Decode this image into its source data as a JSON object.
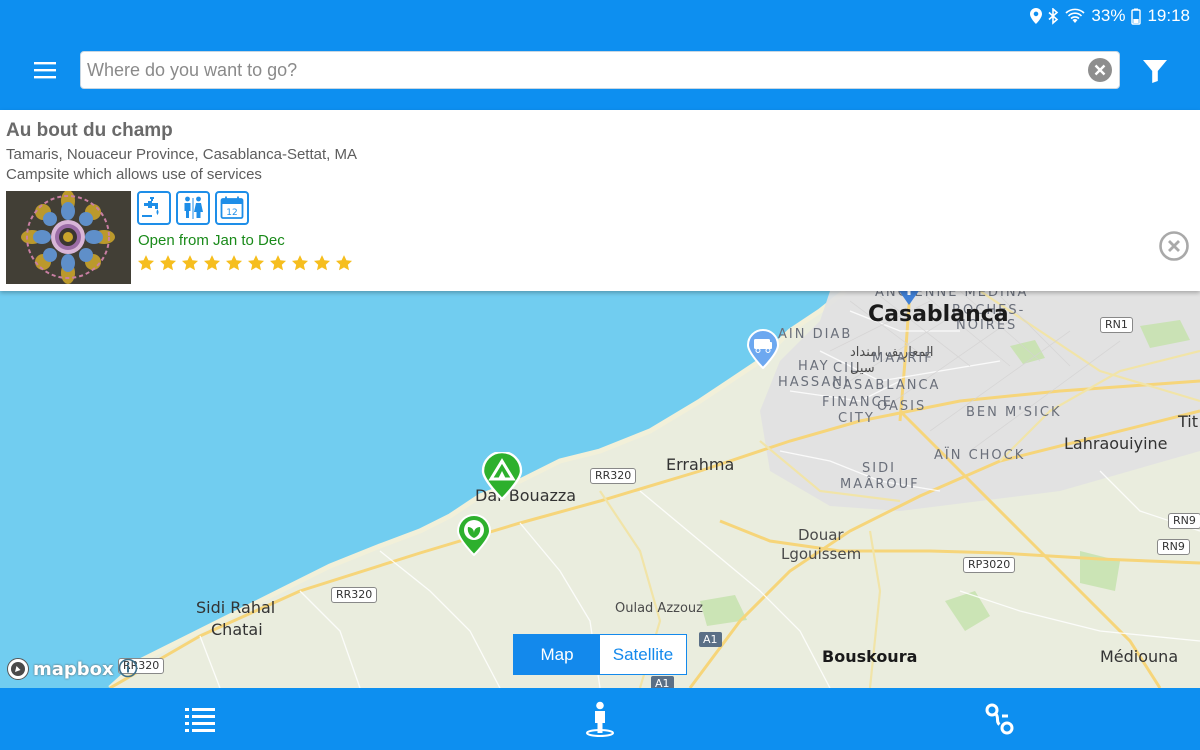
{
  "status_bar": {
    "battery": "33%",
    "time": "19:18"
  },
  "search": {
    "placeholder": "Where do you want to go?"
  },
  "place": {
    "name": "Au bout du champ",
    "address": "Tamaris, Nouaceur Province, Casablanca-Settat, MA",
    "type": "Campsite which allows use of services",
    "services": [
      "water-tap-icon",
      "toilets-icon",
      "calendar-icon"
    ],
    "calendar_number": "12",
    "opening": "Open from Jan to Dec",
    "rating": 10
  },
  "map": {
    "labels": {
      "casablanca": "Casablanca",
      "ain_diab": "AIN DIAB",
      "hay_hassani": "HAY",
      "hay_hassani_2": "HASSANI",
      "cil": "CIL",
      "casablanca_finance": "CASABLANCA",
      "finance": "FINANCE",
      "city": "CITY",
      "oasis": "OASIS",
      "maarif": "MAARIF",
      "ancienne_medina": "ANCIENNE MEDINA",
      "roches_noires": "ROCHES-",
      "noires": "NOIRES",
      "arabic_1": "المعاريف امنداد",
      "arabic_2": "سيل",
      "ben_msick": "BEN M'SICK",
      "lahraouiyine": "Lahraouiyine",
      "tit": "Tit",
      "ain_chock": "AÏN CHOCK",
      "sidi": "SIDI",
      "maarouf": "MAÂROUF",
      "errahma": "Errahma",
      "dar_bouazza": "Dar Bouazza",
      "douar": "Douar",
      "lgouissem": "Lgouissem",
      "sidi_rahal": "Sidi Rahal",
      "chatai": "Chatai",
      "oulad_azzouz": "Oulad Azzouz",
      "bouskoura": "Bouskoura",
      "mediouna": "Médiouna"
    },
    "shields": {
      "rr320_a": "RR320",
      "rr320_b": "RR320",
      "rr320_c": "RR320",
      "rn1": "RN1",
      "rn9_a": "RN9",
      "rn9_b": "RN9",
      "rp3020": "RP3020",
      "a1_a": "A1",
      "a1_b": "A1"
    },
    "toggle": {
      "map": "Map",
      "satellite": "Satellite",
      "selected": "Map"
    },
    "attribution": "mapbox"
  },
  "bottom_nav": [
    "list-icon",
    "person-location-icon",
    "route-icon"
  ]
}
